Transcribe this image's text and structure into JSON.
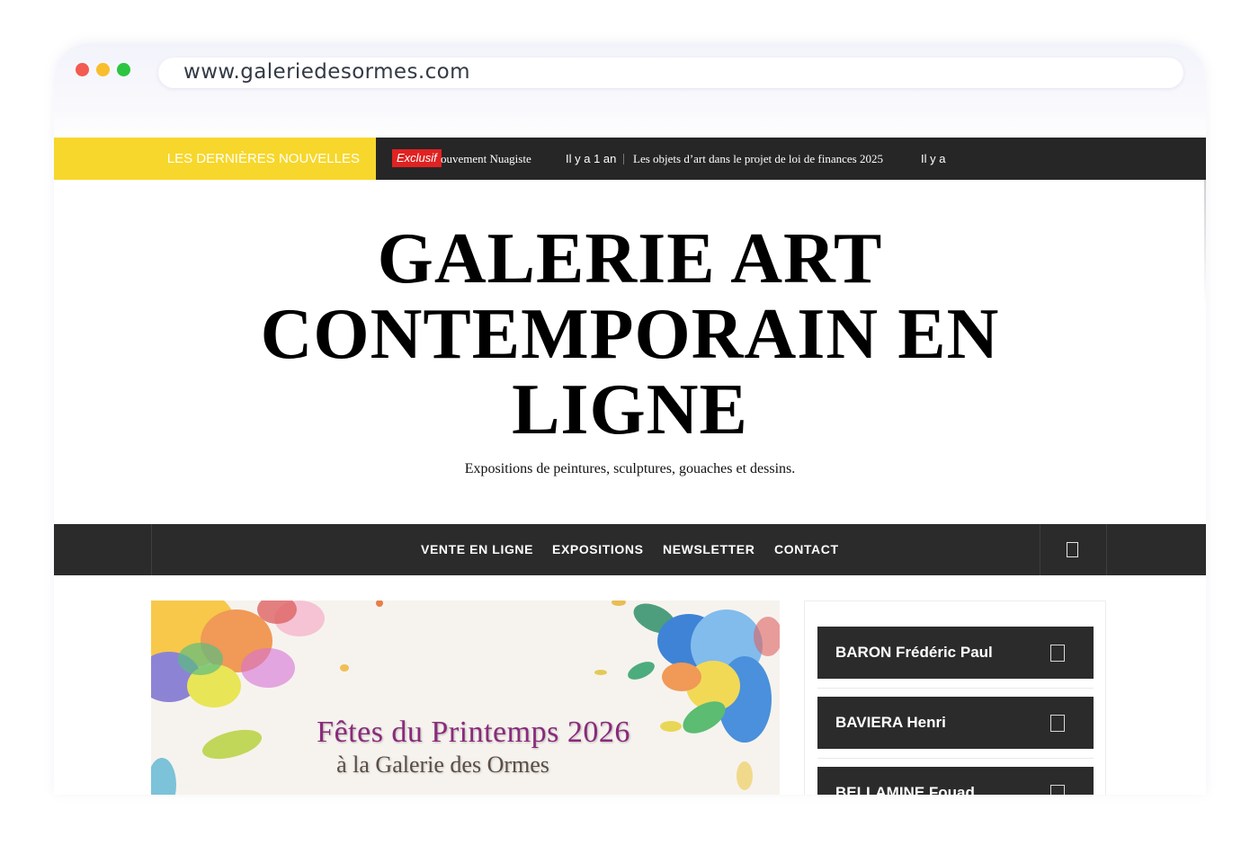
{
  "browser": {
    "url": "www.galeriedesormes.com"
  },
  "ticker": {
    "label": "LES DERNIÈRES NOUVELLES",
    "badge": "Exclusif",
    "items": [
      {
        "text": "ouvement Nuagiste",
        "time": "Il y a 1 an"
      },
      {
        "text": "Les objets d’art dans le projet de loi de finances 2025",
        "time": "Il y a"
      }
    ]
  },
  "site": {
    "title_lines": [
      "GALERIE ART",
      "CONTEMPORAIN EN",
      "LIGNE"
    ],
    "tagline": "Expositions de peintures, sculptures, gouaches et dessins."
  },
  "nav": {
    "items": [
      "VENTE EN LIGNE",
      "EXPOSITIONS",
      "NEWSLETTER",
      "CONTACT"
    ],
    "search_icon": "search-icon"
  },
  "banner": {
    "title": "Fêtes du Printemps 2026",
    "subtitle": "à la Galerie des Ormes"
  },
  "sidebar": {
    "artists": [
      "BARON Frédéric Paul",
      "BAVIERA Henri",
      "BELLAMINE Fouad"
    ]
  },
  "colors": {
    "ticker_label_bg": "#f7d72b",
    "dark_bar": "#2b2b2b",
    "badge_red": "#e02222",
    "banner_title": "#8a2a7b"
  }
}
